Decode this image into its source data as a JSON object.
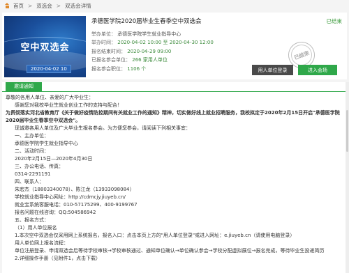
{
  "breadcrumb": {
    "items": [
      "首页",
      "双选会",
      "双选会详情"
    ]
  },
  "banner": {
    "title": "空中双选会",
    "date": "2020-04-02 10"
  },
  "fair": {
    "title": "承德医学院2020届毕业生春季空中双选会",
    "status": "已结束",
    "stamp": "已结束",
    "rows": [
      {
        "label": "举办单位：",
        "value": "承德医学院学生就业指导中心"
      },
      {
        "label": "举办时间：",
        "value": "2020-04-02 10:00 至 2020-04-30 12:00"
      },
      {
        "label": "报名结束时间：",
        "value": "2020-04-29 09:00"
      },
      {
        "label": "已报名参会单位：",
        "value": "266 家用人单位"
      },
      {
        "label": "报名参会职位：",
        "value": "1106 个"
      }
    ],
    "login_button": "用人单位登录",
    "enter_button": "进入会场"
  },
  "tabs": {
    "invitation": "邀请通知"
  },
  "notice": {
    "greeting": "尊敬的各用人单位、亲爱的广大毕业生：",
    "thanks": "感谢您对我校毕业生就业创业工作的支持与配合！",
    "bold_para": "为贯彻落实河北省教育厅《关于做好疫情防控期间有关就业工作的通知》精神，切实做好线上就业招聘服务，我校拟定于2020年2月15日开启\"承德医学院2020届毕业生春季空中双选会\"。",
    "welcome": "现诚邀各用人单位及广大毕业生报名参会。为方便您参会，请阅读下列相关事宜：",
    "s1": "一、主办单位：",
    "s1_v": "承德医学院学生就业指导中心",
    "s2": "二、活动时间：",
    "s2_v": "2020年2月15日—2020年4月30日",
    "s3": "三、办公电话、传真：",
    "s3_v": "0314-2291191",
    "s4": "四、联系人：",
    "s4_v": "朱宏杰（18803340078）、陈江龙（13933098084）",
    "s4_site": "学校就业指导中心网址：http://cdmcjy.jiuyeb.cn/",
    "s4_phone": "就业宝系统客服电话：010-57175299、400-9199767",
    "s4_qq": "报名问题在线咨询：QQ:504586942",
    "s5": "五、报名方式：",
    "s5_1": "（1）用人单位报名",
    "s5_1a": "1.本次空中双选会仅采用网上系统报名，报名入口：点击本页上方的\"用人单位登录\"或进入网址：e.jiuyeb.cn（请使用电脑登录）",
    "s5_1b": "用人单位网上报名流程：",
    "s5_1c": "单位注册登录、申请双选会后等待学校审核→学校审核通过、通知单位确认→单位确认参会→学校分配虚拟展位→报名完成，等待毕业生投递简历",
    "s5_2": "2.详细操作手册（见附件1，点击下载）"
  }
}
